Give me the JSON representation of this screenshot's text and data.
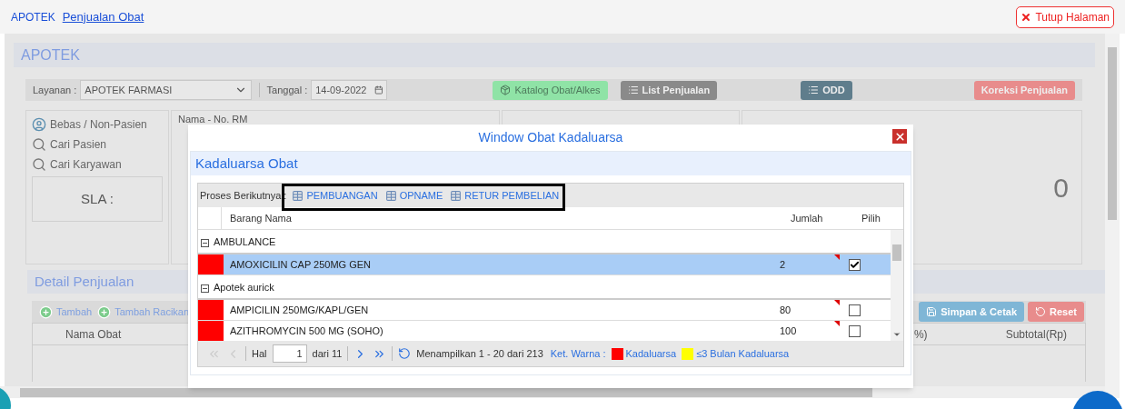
{
  "breadcrumb": [
    {
      "label": "APOTEK",
      "selected": false
    },
    {
      "label": "Penjualan Obat",
      "selected": true
    }
  ],
  "close_page_button": "Tutup Halaman",
  "panel": {
    "title": "APOTEK",
    "service_label": "Layanan :",
    "service_value": "APOTEK FARMASI",
    "date_label": "Tanggal :",
    "date_value": "14-09-2022",
    "buttons": [
      {
        "label": "Katalog Obat/Alkes",
        "kind": "catalog",
        "color": "#8fe3a6"
      },
      {
        "label": "List Penjualan",
        "kind": "list",
        "color": "#8a8a8a"
      },
      {
        "label": "ODD",
        "kind": "list",
        "color": "#5f7d8c"
      },
      {
        "label": "Koreksi Penjualan",
        "kind": "plain",
        "color": "#e88c8c"
      }
    ]
  },
  "patient": {
    "actions": [
      {
        "label": "Bebas / Non-Pasien",
        "kind": "person"
      },
      {
        "label": "Cari Pasien",
        "kind": "search"
      },
      {
        "label": "Cari Karyawan",
        "kind": "search"
      }
    ],
    "sla_label": "SLA :",
    "info_label": "Nama - No. RM",
    "total": "0"
  },
  "detail": {
    "title": "Detail Penjualan",
    "add_buttons": [
      "Tambah",
      "Tambah Racikan"
    ],
    "action_buttons": [
      {
        "label": "Simpan & Cetak",
        "kind": "save",
        "color": "#7fb6d6"
      },
      {
        "label": "Reset",
        "kind": "reset",
        "color": "#e88c8c"
      }
    ],
    "columns": [
      "Nama Obat",
      "%)",
      "Subtotal(Rp)"
    ]
  },
  "modal": {
    "title": "Window Obat Kadaluarsa",
    "panel_title": "Kadaluarsa Obat",
    "process_label": "Proses Berikutnya :",
    "process_buttons": [
      "PEMBUANGAN",
      "OPNAME",
      "RETUR PEMBELIAN"
    ],
    "columns": [
      "Barang Nama",
      "Jumlah",
      "Pilih"
    ],
    "groups": [
      {
        "name": "AMBULANCE",
        "expanded": true,
        "items": [
          {
            "name": "AMOXICILIN CAP 250MG GEN",
            "qty": "2",
            "color": "#ff0000",
            "checked": true,
            "selected": true
          }
        ]
      },
      {
        "name": "Apotek aurick",
        "expanded": true,
        "items": [
          {
            "name": "AMPICILIN 250MG/KAPL/GEN",
            "qty": "80",
            "color": "#ff0000",
            "checked": false,
            "selected": false
          },
          {
            "name": "AZITHROMYCIN 500 MG (SOHO)",
            "qty": "100",
            "color": "#ff0000",
            "checked": false,
            "selected": false
          }
        ]
      }
    ],
    "pager": {
      "page_label": "Hal",
      "page_value": "1",
      "page_of": "dari 11",
      "summary": "Menampilkan 1 - 20 dari 213",
      "legend_label": "Ket. Warna :",
      "legend": [
        {
          "label": "Kadaluarsa",
          "color": "#ff0000"
        },
        {
          "label": "≤3 Bulan Kadaluarsa",
          "color": "#ffff00"
        }
      ]
    }
  }
}
